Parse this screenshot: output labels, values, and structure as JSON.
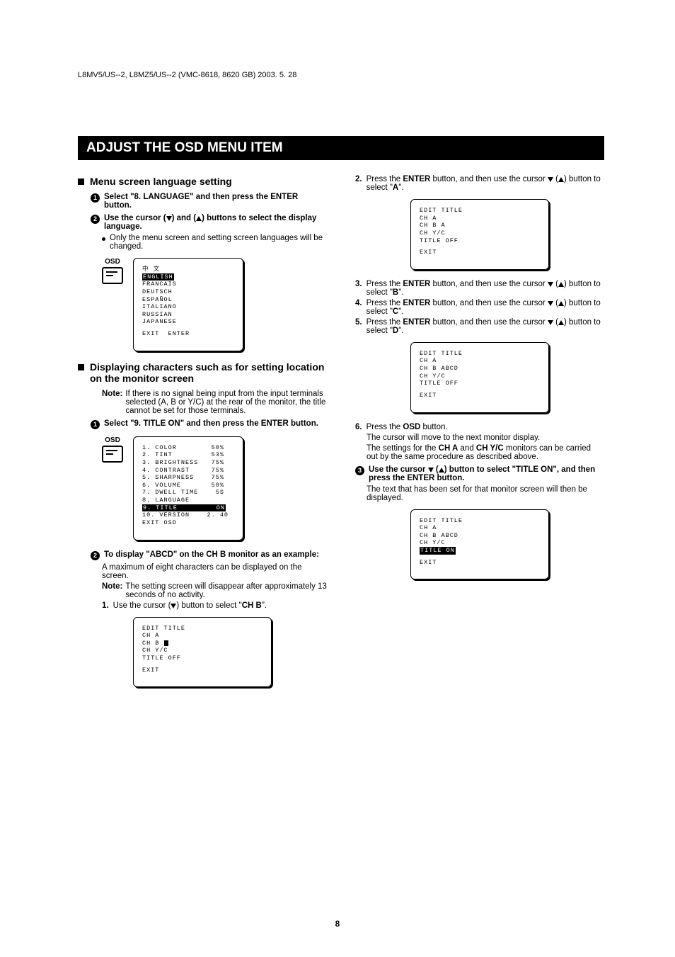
{
  "doc_header": "L8MV5/US--2, L8MZ5/US--2 (VMC-8618, 8620 GB) 2003. 5. 28",
  "title": "ADJUST THE OSD MENU ITEM",
  "page_number": "8",
  "left": {
    "sec1_title": "Menu screen language setting",
    "step1": "Select \"8. LANGUAGE\" and then press the ENTER button.",
    "step2_pre": "Use the cursor (",
    "step2_mid": ") and (",
    "step2_post": ") buttons to select the display language.",
    "bullet1": "Only the menu screen and setting screen languages will be changed.",
    "osd_label": "OSD",
    "lang_screen": {
      "l1": "中 文",
      "l2": "ENGLISH",
      "l3": "FRANCAIS",
      "l4": "DEUTSCH",
      "l5": "ESPAÑOL",
      "l6": "ITALIANO",
      "l7": "RUSSIAN",
      "l8": "JAPANESE",
      "footer": "EXIT  ENTER"
    },
    "sec2_title": "Displaying characters such as for setting location on the monitor screen",
    "note_label": "Note:",
    "note1": "If there is no signal being input from the input terminals selected (A, B or Y/C) at the rear of the monitor, the title cannot be set for those terminals.",
    "sec2_step1": "Select \"9. TITLE ON\" and then press the ENTER button.",
    "menu_screen": {
      "r1": "1. COLOR        50%",
      "r2": "2. TINT         53%",
      "r3": "3. BRIGHTNESS   75%",
      "r4": "4. CONTRAST     75%",
      "r5": "5. SHARPNESS    75%",
      "r6": "6. VOLUME       50%",
      "r7": "7. DWELL TIME    5S",
      "r8": "8. LANGUAGE",
      "r9a": "9. TITLE",
      "r9b": "ON",
      "r10": "10. VERSION    2. 40",
      "r11": "EXIT OSD"
    },
    "sec2_step2": "To display \"ABCD\" on the CH B monitor as an example:",
    "sec2_step2_body": "A maximum of eight characters can be displayed on the screen.",
    "note2": "The setting screen will disappear after approximately 13 seconds of no activity.",
    "sub1_num": "1.",
    "sub1_pre": "Use the cursor (",
    "sub1_post": ") button to select \"",
    "sub1_bold": "CH B",
    "sub1_end": "\".",
    "edit_screen1": {
      "l1": "EDIT TITLE",
      "l2": "CH A",
      "l3a": "CH B ",
      "l4": "CH Y/C",
      "l5": "TITLE OFF",
      "l6": "EXIT"
    }
  },
  "right": {
    "s2_num": "2.",
    "s2_pre": "Press the ",
    "s2_enter": "ENTER",
    "s2_mid": " button, and then use the cursor ",
    "s2_mid2": " (",
    "s2_post": ") button to select \"",
    "s2_bold": "A",
    "s2_end": "\".",
    "edit_screen2": {
      "l1": "EDIT TITLE",
      "l2": "CH A",
      "l3": "CH B A",
      "l4": "CH Y/C",
      "l5": "TITLE OFF",
      "l6": "EXIT"
    },
    "s3_num": "3.",
    "s3_bold": "B",
    "s4_num": "4.",
    "s4_bold": "C",
    "s5_num": "5.",
    "s5_bold": "D",
    "edit_screen3": {
      "l1": "EDIT TITLE",
      "l2": "CH A",
      "l3": "CH B ABCD",
      "l4": "CH Y/C",
      "l5": "TITLE OFF",
      "l6": "EXIT"
    },
    "s6_num": "6.",
    "s6_pre": "Press the ",
    "s6_bold": "OSD",
    "s6_post": " button.",
    "s6_body1": "The cursor will move to the next monitor display.",
    "s6_body2_pre": "The settings for the ",
    "s6_body2_b1": "CH A",
    "s6_body2_mid": " and ",
    "s6_body2_b2": "CH Y/C",
    "s6_body2_post": " monitors can be carried out by the same procedure as described above.",
    "step3_pre": "Use the cursor ",
    "step3_mid": " (",
    "step3_post": ") button to select \"TITLE ON\", and then press the ENTER button.",
    "step3_body": "The text that has been set for that monitor screen will then be displayed.",
    "edit_screen4": {
      "l1": "EDIT TITLE",
      "l2": "CH A",
      "l3": "CH B ABCD",
      "l4": "CH Y/C",
      "l5": "TITLE ON",
      "l6": "EXIT"
    }
  }
}
